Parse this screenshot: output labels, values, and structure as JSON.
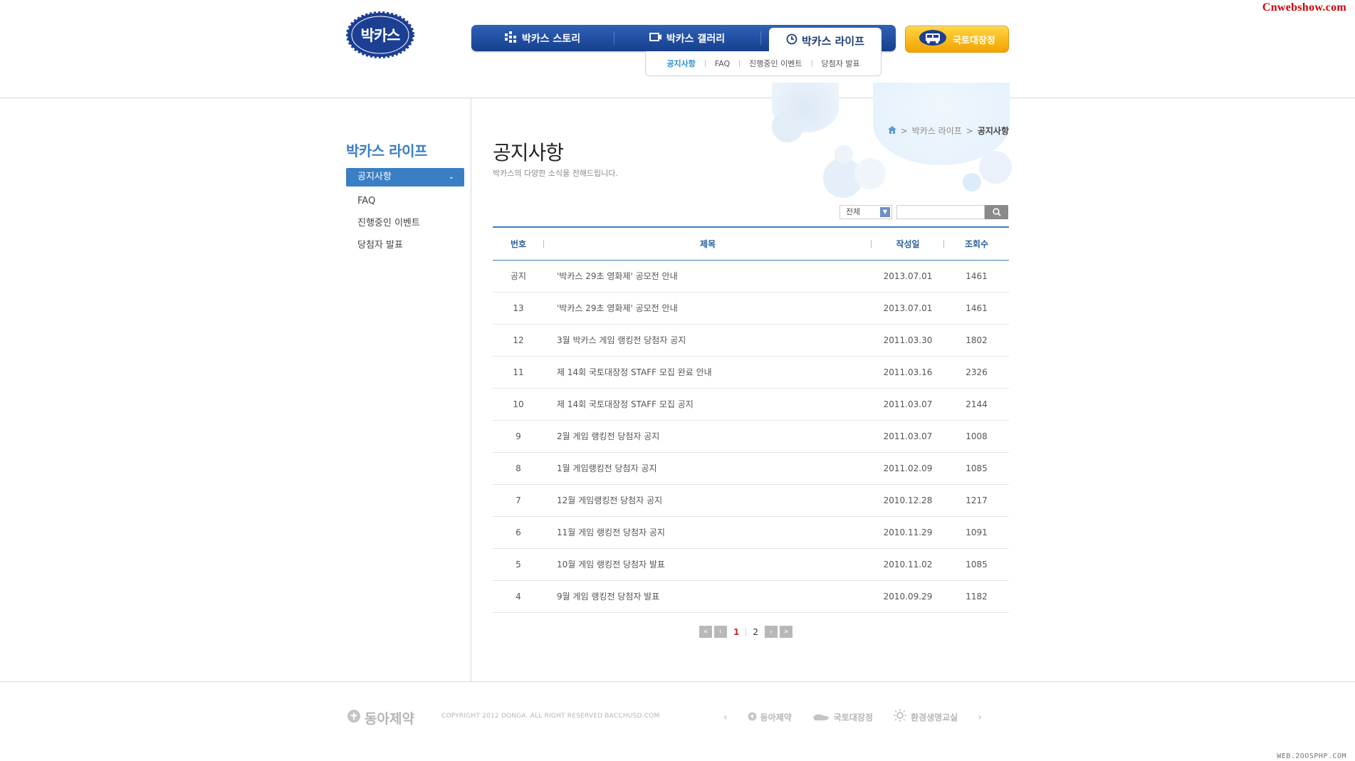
{
  "watermark": {
    "top": "Cnwebshow.com",
    "bottom": "WEB.2OOSPHP.COM"
  },
  "header": {
    "logo_text": "박카스",
    "nav": [
      {
        "label": "박카스 스토리",
        "icon": "building-grid-icon"
      },
      {
        "label": "박카스 갤러리",
        "icon": "film-icon"
      },
      {
        "label": "박카스 라이프",
        "icon": "clock-icon"
      }
    ],
    "subnav": [
      "공지사항",
      "FAQ",
      "진행중인 이벤트",
      "당첨자 발표"
    ],
    "cta_label": "국토대장정",
    "colors": {
      "nav_blue": "#1e4a9c",
      "cta_orange": "#f2a300",
      "accent_blue": "#3a7fc4"
    }
  },
  "sidebar": {
    "title": "박카스 라이프",
    "items": [
      "공지사항",
      "FAQ",
      "진행중인 이벤트",
      "당첨자 발표"
    ]
  },
  "breadcrumb": [
    "박카스 라이프",
    "공지사항"
  ],
  "page": {
    "title": "공지사항",
    "description": "박카스의 다양한 소식을 전해드립니다."
  },
  "search": {
    "select_value": "전체",
    "input_value": ""
  },
  "table": {
    "headers": [
      "번호",
      "제목",
      "작성일",
      "조회수"
    ],
    "rows": [
      {
        "no": "공지",
        "title": "'박카스 29초 영화제' 공모전 안내",
        "date": "2013.07.01",
        "views": "1461"
      },
      {
        "no": "13",
        "title": "'박카스 29초 영화제' 공모전 안내",
        "date": "2013.07.01",
        "views": "1461"
      },
      {
        "no": "12",
        "title": "3월 박카스 게임 랭킹전 당첨자 공지",
        "date": "2011.03.30",
        "views": "1802"
      },
      {
        "no": "11",
        "title": "제 14회 국토대장정 STAFF 모집 완료 안내",
        "date": "2011.03.16",
        "views": "2326"
      },
      {
        "no": "10",
        "title": "제 14회 국토대장정 STAFF 모집 공지",
        "date": "2011.03.07",
        "views": "2144"
      },
      {
        "no": "9",
        "title": "2월 게임 랭킹전 당첨자 공지",
        "date": "2011.03.07",
        "views": "1008"
      },
      {
        "no": "8",
        "title": "1월 게임랭킹전 당첨자 공지",
        "date": "2011.02.09",
        "views": "1085"
      },
      {
        "no": "7",
        "title": "12월 게임랭킹전 당첨자 공지",
        "date": "2010.12.28",
        "views": "1217"
      },
      {
        "no": "6",
        "title": "11월 게임 랭킹전 당첨자 공지",
        "date": "2010.11.29",
        "views": "1091"
      },
      {
        "no": "5",
        "title": "10월 게임 랭킹전 당첨자 발표",
        "date": "2010.11.02",
        "views": "1085"
      },
      {
        "no": "4",
        "title": "9월 게임 랭킹전 당첨자 발표",
        "date": "2010.09.29",
        "views": "1182"
      }
    ]
  },
  "pagination": {
    "pages": [
      "1",
      "2"
    ],
    "current": "1"
  },
  "footer": {
    "logo_text": "동아제약",
    "copyright": "COPYRIGHT 2012 DONGA.  ALL RIGHT RESERVED BACCHUSD.COM",
    "links": [
      "동아제약",
      "국토대장정",
      "환경생명교실"
    ]
  }
}
